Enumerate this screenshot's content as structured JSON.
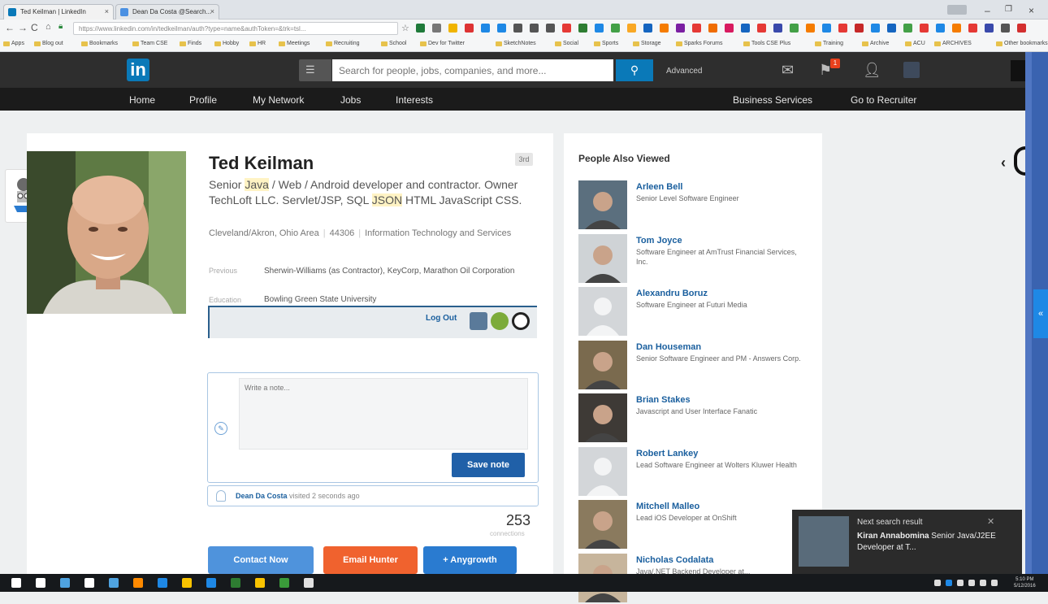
{
  "browser": {
    "tabs": [
      {
        "label": "Ted Keilman | LinkedIn"
      },
      {
        "label": "Dean Da Costa @Search..."
      }
    ],
    "url": "https://www.linkedin.com/in/tedkeilman/auth?type=name&authToken=&trk=tsl..."
  },
  "bookmarks": [
    "Apps",
    "Blog out",
    "Bookmarks",
    "Team CSE",
    "Finds",
    "Hobby",
    "HR",
    "Meetings",
    "Recruiting",
    "School",
    "Dev for Twitter",
    "SketchNotes",
    "Social",
    "Sports",
    "Storage",
    "Sparks Forums",
    "Tools CSE Plus",
    "Training",
    "Archive",
    "ACU",
    "ARCHIVES",
    "Other bookmarks"
  ],
  "linkedin": {
    "logo": "in",
    "search_placeholder": "Search for people, jobs, companies, and more...",
    "advanced": "Advanced",
    "notification_count": "1",
    "nav": [
      "Home",
      "Profile",
      "My Network",
      "Jobs",
      "Interests"
    ],
    "nav_right": [
      "Business Services",
      "Go to Recruiter"
    ]
  },
  "profile": {
    "name": "Ted Keilman",
    "degree": "3rd",
    "headline_parts": [
      "Senior ",
      "Java",
      " / Web / Android developer and contractor. Owner TechLoft LLC. Servlet/JSP, SQL ",
      "JSON",
      " HTML JavaScript CSS."
    ],
    "location": "Cleveland/Akron, Ohio Area",
    "zip": "44306",
    "industry": "Information Technology and Services",
    "previous_label": "Previous",
    "previous": "Sherwin-Williams (as Contractor), KeyCorp, Marathon Oil Corporation",
    "education_label": "Education",
    "education": "Bowling Green State University",
    "logout": "Log Out",
    "note_placeholder": "Write a note...",
    "save_note": "Save note",
    "visited_name": "Dean Da Costa",
    "visited_text": " visited 2 seconds ago",
    "connections": "253",
    "connections_label": "connections",
    "buttons": [
      "Contact Now",
      "Email Hunter",
      "+ Anygrowth"
    ]
  },
  "people_also_viewed": {
    "title": "People Also Viewed",
    "people": [
      {
        "name": "Arleen Bell",
        "title": "Senior Level Software Engineer"
      },
      {
        "name": "Tom Joyce",
        "title": "Software Engineer at AmTrust Financial Services, Inc."
      },
      {
        "name": "Alexandru Boruz",
        "title": "Software Engineer at Futuri Media"
      },
      {
        "name": "Dan Houseman",
        "title": "Senior Software Engineer and PM - Answers Corp."
      },
      {
        "name": "Brian Stakes",
        "title": "Javascript and User Interface Fanatic"
      },
      {
        "name": "Robert Lankey",
        "title": "Lead Software Engineer at Wolters Kluwer Health"
      },
      {
        "name": "Mitchell Malleo",
        "title": "Lead iOS Developer at OnShift"
      },
      {
        "name": "Nicholas Codalata",
        "title": "Java/.NET Backend Developer at..."
      }
    ]
  },
  "toast": {
    "title": "Next search result",
    "name": "Kiran Annabomina",
    "rest": " Senior Java/J2EE Developer at T..."
  },
  "taskbar": {
    "time": "5:10 PM",
    "date": "5/12/2016"
  },
  "colors": {
    "linkedin_blue": "#0a79b8",
    "header": "#2e2e2e",
    "save_button": "#2060a8",
    "contact_button": "#4f93dc",
    "email_hunter": "#f0622e",
    "anygrowth": "#2a7bd0"
  }
}
